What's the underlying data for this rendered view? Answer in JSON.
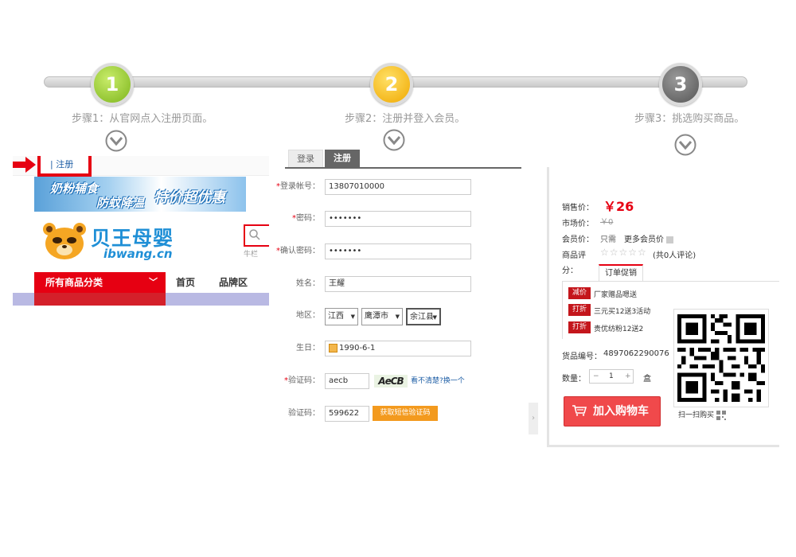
{
  "steps": [
    {
      "number": "1",
      "label": "步骤1：从官网点入注册页面。"
    },
    {
      "number": "2",
      "label": "步骤2：注册并登入会员。"
    },
    {
      "number": "3",
      "label": "步骤3：挑选购买商品。"
    }
  ],
  "panel1": {
    "register_link": "| 注册",
    "banner": {
      "line1": "奶粉辅食",
      "line2": "防蚊降温",
      "line3": "特价超优惠"
    },
    "logo_cn": "贝王母婴",
    "logo_en": "ibwang.cn",
    "hot_words": "牛栏",
    "nav": {
      "category": "所有商品分类",
      "home": "首页",
      "brand": "品牌区"
    },
    "colors": {
      "accent_red": "#e60012",
      "logo_blue": "#1f8fd6"
    }
  },
  "panel2": {
    "tabs": {
      "login": "登录",
      "register": "注册"
    },
    "fields": {
      "account": {
        "label": "登录帐号：",
        "value": "13807010000"
      },
      "password": {
        "label": "密码：",
        "value": "•••••••"
      },
      "confirm": {
        "label": "确认密码：",
        "value": "•••••••"
      },
      "name": {
        "label": "姓名：",
        "value": "王耀"
      },
      "region": {
        "label": "地区：",
        "province": "江西",
        "city": "鹰潭市",
        "county": "余江县"
      },
      "birthday": {
        "label": "生日：",
        "value": "1990-6-1"
      },
      "captcha": {
        "label": "验证码：",
        "value": "aecb",
        "image_text": "AeCB",
        "refresh": "看不清楚?换一个"
      },
      "sms": {
        "label": "验证码：",
        "value": "599622",
        "button": "获取短信验证码"
      }
    },
    "required_mark": "*"
  },
  "panel3": {
    "sale_price_label": "销售价：",
    "sale_price": "￥26",
    "market_price_label": "市场价：",
    "market_price": "￥0",
    "member_price_label": "会员价：",
    "member_price": "只需",
    "more_member_price": "更多会员价",
    "rating_label_1": "商品评",
    "rating_label_2": "分：",
    "stars": "☆☆☆☆☆",
    "review_count": "(共0人评论)",
    "promo_tab": "订单促销",
    "promos": [
      {
        "tag": "减价",
        "text": "厂家赠品嗯送"
      },
      {
        "tag": "打折",
        "text": "三元买12送3活动"
      },
      {
        "tag": "打折",
        "text": "贵优纺粉12送2"
      }
    ],
    "sku_label": "货品编号：",
    "sku": "4897062290076",
    "qty_label": "数量：",
    "qty_minus": "−",
    "qty_value": "1",
    "qty_plus": "+",
    "unit": "盒",
    "add_to_cart": "加入购物车",
    "scan_buy": "扫一扫购买"
  }
}
